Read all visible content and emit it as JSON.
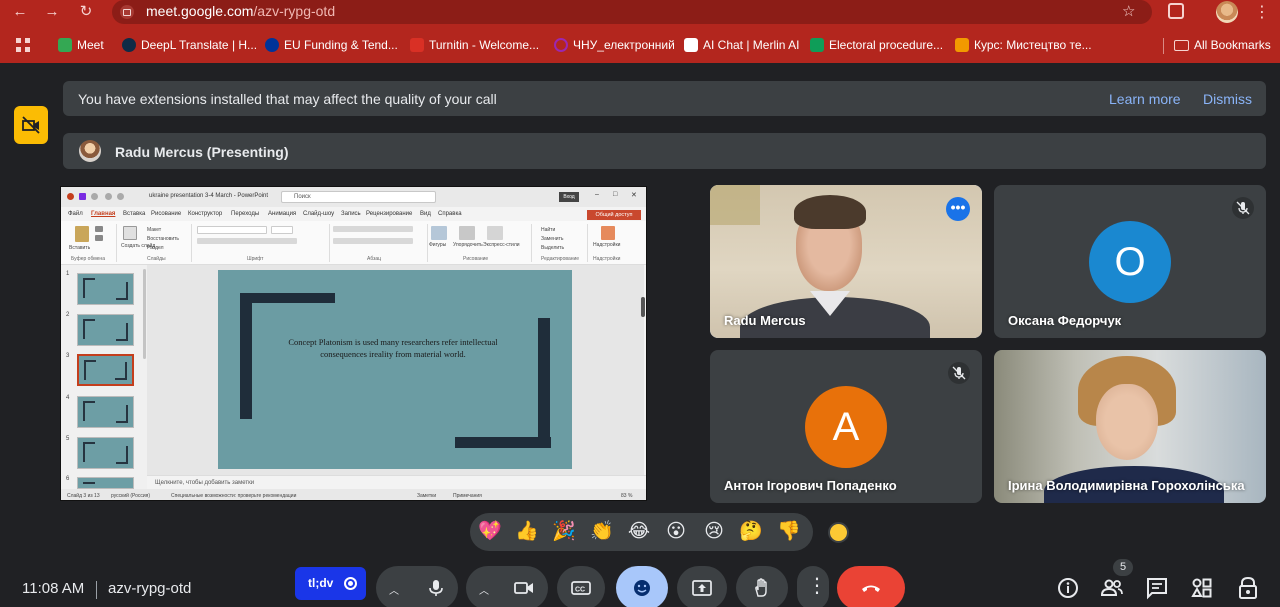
{
  "browser": {
    "url_host": "meet.google.com",
    "url_path": "/azv-rypg-otd",
    "bookmarks": [
      {
        "label": "Meet",
        "icon": "meet-icon",
        "color": "#34a853"
      },
      {
        "label": "DeepL Translate | H...",
        "icon": "deepl-icon",
        "color": "#0f2b46"
      },
      {
        "label": "EU Funding & Tend...",
        "icon": "eu-icon",
        "color": "#003399"
      },
      {
        "label": "Turnitin - Welcome...",
        "icon": "turnitin-icon",
        "color": "#d93025"
      },
      {
        "label": "ЧНУ_електронний",
        "icon": "chnu-icon",
        "color": "#9c27b0"
      },
      {
        "label": "AI Chat | Merlin AI",
        "icon": "merlin-icon",
        "color": "#ffffff"
      },
      {
        "label": "Electoral procedure...",
        "icon": "doc-icon",
        "color": "#0f9d58"
      },
      {
        "label": "Курс: Мистецтво те...",
        "icon": "course-icon",
        "color": "#f29900"
      }
    ],
    "all_bookmarks": "All Bookmarks"
  },
  "banner": {
    "text": "You have extensions installed that may affect the quality of your call",
    "learn_more": "Learn more",
    "dismiss": "Dismiss"
  },
  "presenter": {
    "label": "Radu Mercus (Presenting)"
  },
  "presentation": {
    "window_title": "ukraine presentation 3-4 March  -  PowerPoint",
    "search_placeholder": "Поиск",
    "login": "Вход",
    "tabs": [
      "Файл",
      "Главная",
      "Вставка",
      "Рисование",
      "Конструктор",
      "Переходы",
      "Анимация",
      "Слайд-шоу",
      "Запись",
      "Рецензирование",
      "Вид",
      "Справка"
    ],
    "share_btn": "Общий доступ",
    "ribbon_groups": [
      "Буфер обмена",
      "Слайды",
      "Шрифт",
      "Абзац",
      "Рисование",
      "Редактирование",
      "Надстройки"
    ],
    "ribbon_labels": {
      "paste": "Вставить",
      "create_slide": "Создать слайд",
      "layout": "Макет",
      "reset": "Восстановить",
      "section": "Раздел",
      "shapes": "Фигуры",
      "arrange": "Упорядочить",
      "quick_styles": "Экспресс-стили",
      "find": "Найти",
      "replace": "Заменить",
      "select": "Выделить",
      "addins": "Надстройки"
    },
    "slide_numbers": [
      "1",
      "2",
      "3",
      "4",
      "5",
      "6"
    ],
    "selected_slide": 3,
    "slide_text": "Concept Platonism is used many researchers refer intellectual consequences ireality from material world.",
    "notes_placeholder": "Щелкните, чтобы добавить заметки",
    "status": {
      "slide": "Слайд 3 из 13",
      "language": "русский (Россия)",
      "accessibility": "Специальные возможности: проверьте рекомендации",
      "notes": "Заметки",
      "comments": "Примечания",
      "zoom": "83 %"
    }
  },
  "participants": [
    {
      "name": "Radu Mercus",
      "type": "video",
      "active_speaker": true
    },
    {
      "name": "Оксана Федорчук",
      "type": "avatar",
      "letter": "O",
      "color": "#1a88d0",
      "muted": true
    },
    {
      "name": "Антон Ігорович Попаденко",
      "type": "avatar",
      "letter": "A",
      "color": "#e8710a",
      "muted": true
    },
    {
      "name": "Ірина Володимирівна Горохолінська",
      "type": "video"
    }
  ],
  "reactions": [
    "💖",
    "👍",
    "🎉",
    "👏",
    "😂",
    "😮",
    "😢",
    "🤔",
    "👎"
  ],
  "controls": {
    "time": "11:08 AM",
    "meeting_code": "azv-rypg-otd",
    "extension_chip": "tl;dv",
    "people_count": "5"
  }
}
